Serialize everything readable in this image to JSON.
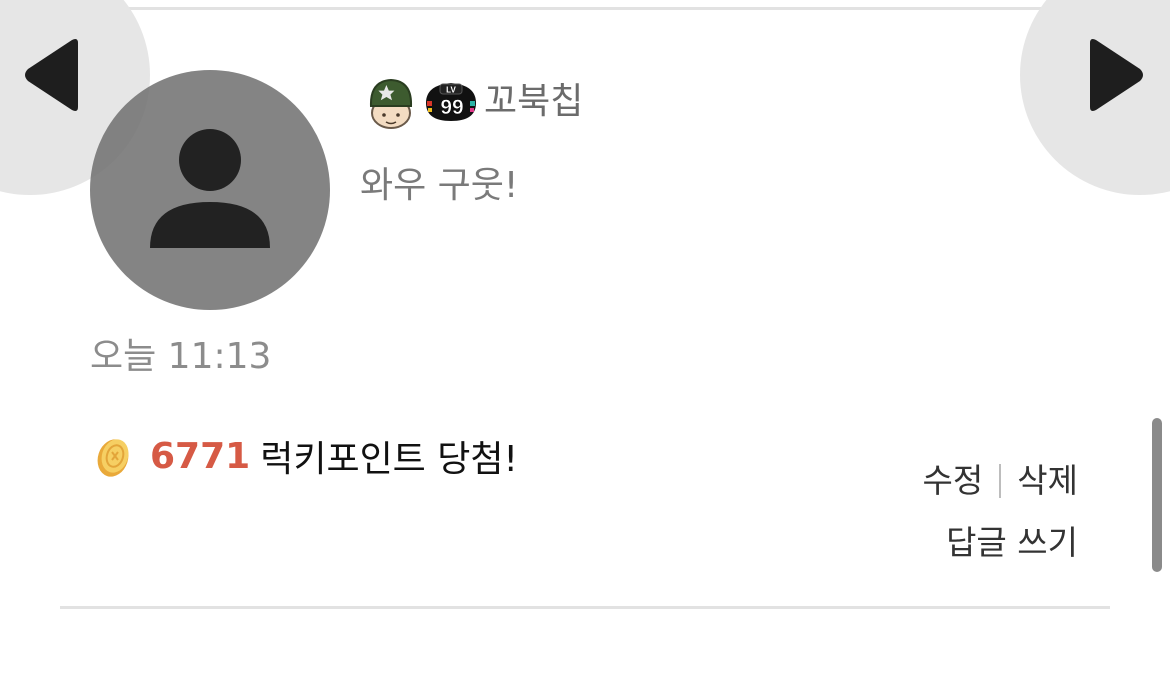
{
  "navigation": {
    "prev_icon": "triangle-left-icon",
    "next_icon": "triangle-right-icon"
  },
  "comment": {
    "avatar_icon": "default-user-icon",
    "badge_icon": "helmet-star-badge-icon",
    "level_icon": "level-99-badge-icon",
    "level_tag": "LV",
    "level_value": "99",
    "author": "꼬북칩",
    "text": "와우 구웃!",
    "timestamp": "오늘 11:13"
  },
  "lucky": {
    "coin_icon": "gold-coin-icon",
    "points": "6771",
    "message": "럭키포인트 당첨!"
  },
  "actions": {
    "edit_label": "수정",
    "delete_label": "삭제",
    "reply_label": "답글 쓰기"
  },
  "colors": {
    "points_accent": "#d65a45",
    "divider": "#e2e2e2",
    "avatar_bg": "#6e6e6e"
  }
}
